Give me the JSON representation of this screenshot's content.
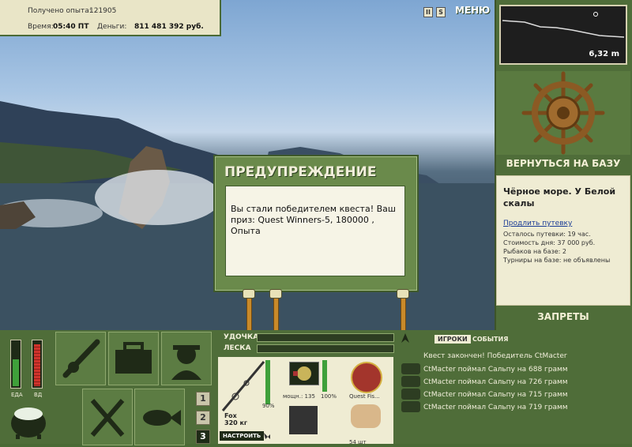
{
  "stats": {
    "xp_label": "Получено опыта:",
    "xp_value": "121905",
    "time_label": "Время:",
    "time_value": "05:40 ПТ",
    "money_label": "Деньги:",
    "money_value": "811 481 392 руб."
  },
  "top_controls": {
    "pause_label": "II",
    "sound_label": "S",
    "menu_label": "МЕНЮ"
  },
  "depth": {
    "value": "6,32 m"
  },
  "base": {
    "return_label": "ВЕРНУТЬСЯ НА БАЗУ",
    "location_title": "Чёрное море. У Белой скалы",
    "extend_link": "Продлить путевку",
    "info_lines": [
      "Осталось путевки: 19 час.",
      "Стоимость дня: 37 000 руб.",
      "Рыбаков на базе: 2",
      "Турниры на базе: не объявлены"
    ],
    "forbid_label": "ЗАПРЕТЫ"
  },
  "dialog": {
    "title": "ПРЕДУПРЕЖДЕНИЕ",
    "text": "Вы стали победителем квеста! Ваш приз: Quest Winners-5, 180000 , Опыта"
  },
  "gauges": {
    "food_label": "ЕДА",
    "hp_label": "ВД",
    "food_level": 0.6,
    "hp_level": 0.95
  },
  "pages": [
    "1",
    "2",
    "3"
  ],
  "rod": {
    "rod_label": "УДОЧКА",
    "line_label": "ЛЕСКА",
    "rod_name": "Fox",
    "rod_weight": "320 кг",
    "rod_percent": "90%",
    "setup_label": "НАСТРОИТЬ",
    "reel_label": "мощн.: 135",
    "reel_percent": "100%",
    "line_name": "Quest Fis...",
    "bait_qty": "54 шт"
  },
  "events": {
    "tab_players": "ИГРОКИ",
    "tab_events": "СОБЫТИЯ",
    "quest_done": "Квест закончен! Победитель CtMacter",
    "catches": [
      "CtMacter поймал Сальпу на 688 грамм",
      "CtMacter поймал Сальпу на 726 грамм",
      "CtMacter поймал Сальпу на 715 грамм",
      "CtMacter поймал Сальпу на 719 грамм"
    ]
  },
  "colors": {
    "panel_green": "#4f6d39",
    "panel_light": "#efecd3",
    "title_text": "#f2efdb"
  }
}
